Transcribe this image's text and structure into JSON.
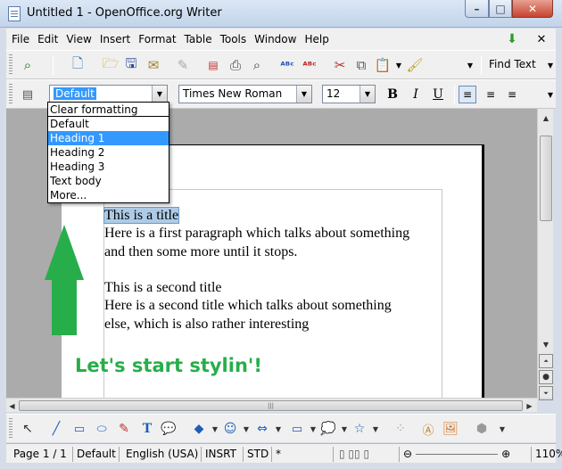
{
  "window": {
    "title": "Untitled 1 - OpenOffice.org Writer",
    "minimize": "–",
    "maximize": "□",
    "close": "✕"
  },
  "menubar": {
    "items": [
      "File",
      "Edit",
      "View",
      "Insert",
      "Format",
      "Table",
      "Tools",
      "Window",
      "Help"
    ]
  },
  "standard_toolbar": {
    "find_text_label": "Find Text"
  },
  "format_toolbar": {
    "paragraph_style": "Default",
    "font_name": "Times New Roman",
    "font_size": "12",
    "bold": "B",
    "italic": "I",
    "underline": "U"
  },
  "style_dropdown": {
    "options": [
      "Clear formatting",
      "Default",
      "Heading 1",
      "Heading 2",
      "Heading 3",
      "Text body",
      "More..."
    ],
    "highlighted": "Heading 1"
  },
  "document": {
    "lines": [
      "This is a title",
      "Here is a first paragraph which talks about something",
      "and then some more until it stops.",
      "",
      "This is a second title",
      "Here is a second title which talks about something",
      "else, which is also rather interesting"
    ],
    "selected_line": "This is a title"
  },
  "annotation": {
    "callout_text": "Let's start stylin'!",
    "color": "#27ae4a"
  },
  "statusbar": {
    "page": "Page 1 / 1",
    "style": "Default",
    "language": "English (USA)",
    "insert_mode": "INSRT",
    "selection_mode": "STD",
    "modified": "*",
    "zoom": "110%"
  },
  "colors": {
    "accent": "#3399ff",
    "selection": "#aecbe6",
    "arrow": "#27ae4a"
  }
}
